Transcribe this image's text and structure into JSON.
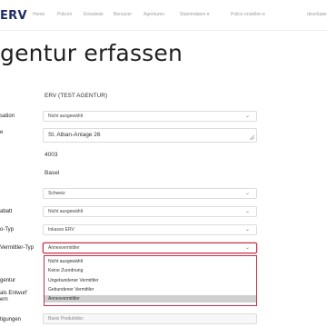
{
  "navbar": {
    "brand": "ERV",
    "items": [
      "Home",
      "Policen",
      "Einwände",
      "Benutzer",
      "Agenturen",
      "Stammdaten",
      "Police erstellen"
    ],
    "user": "developer"
  },
  "page": {
    "title": "gentur erfassen"
  },
  "labels": {
    "organisation": "sation",
    "strasse": "e",
    "rabatt": "abatt",
    "typ": "o-Typ",
    "vermittler_typ": "Vermittler-Typ",
    "agentur": "gentur",
    "entwurf_1": "als Entwurf",
    "entwurf_2": "ern",
    "bestaetigungen": "tigungen"
  },
  "form": {
    "name": "ERV (TEST AGENTUR)",
    "organisation": "Nicht ausgewählt",
    "strasse": "St. Alban-Anlage 26",
    "plz": "4003",
    "ort": "Basel",
    "land": "Schweiz",
    "rabatt": "Nicht ausgewählt",
    "typ": "Inkasso ERV",
    "vermittler_typ": "Annexvermittler",
    "bestaetigungen": "Basis Produktdoc"
  },
  "dropdown": {
    "options": [
      "Nicht ausgewählt",
      "Keine Zuordnung",
      "Ungebundener Vermittler",
      "Gebundener Vermittler",
      "Annexvermittler"
    ],
    "selected_index": 4
  },
  "colors": {
    "brand": "#1f2c6a",
    "focus": "#c6314a"
  }
}
